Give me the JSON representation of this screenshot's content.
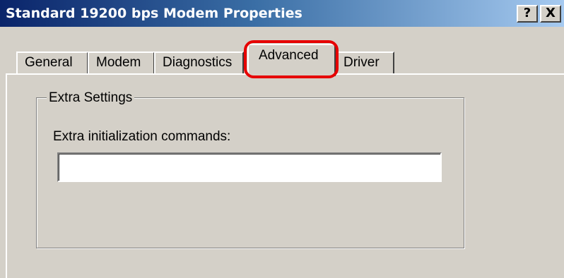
{
  "window": {
    "title": "Standard 19200 bps Modem Properties",
    "help_label": "?",
    "close_label": "X"
  },
  "tabs": [
    {
      "label": "General",
      "active": false
    },
    {
      "label": "Modem",
      "active": false
    },
    {
      "label": "Diagnostics",
      "active": false
    },
    {
      "label": "Advanced",
      "active": true
    },
    {
      "label": "Driver",
      "active": false
    }
  ],
  "advanced": {
    "group_title": "Extra Settings",
    "field_label": "Extra initialization commands:",
    "field_value": "",
    "field_placeholder": ""
  },
  "colors": {
    "titlebar_start": "#0a246a",
    "titlebar_end": "#a6caf0",
    "dialog_face": "#d4d0c8",
    "highlight": "#e60000"
  }
}
